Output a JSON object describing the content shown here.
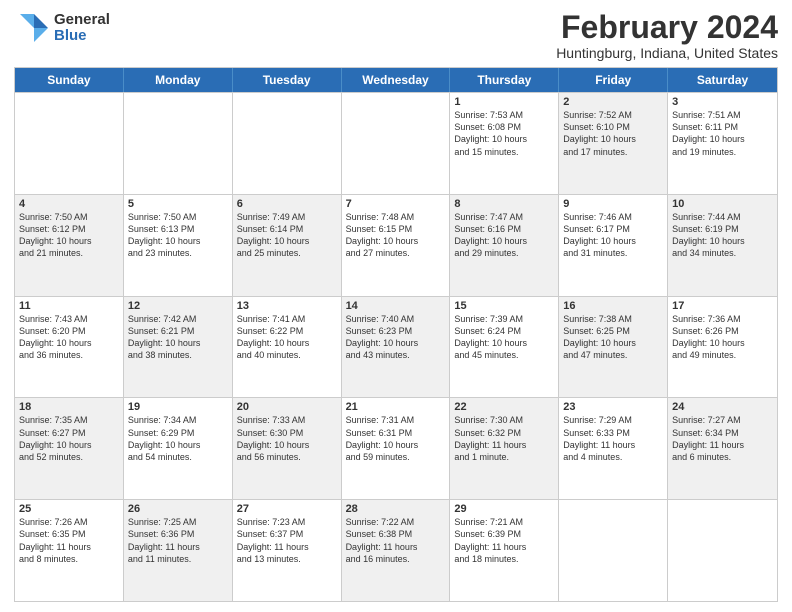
{
  "logo": {
    "general": "General",
    "blue": "Blue"
  },
  "title": "February 2024",
  "subtitle": "Huntingburg, Indiana, United States",
  "header_days": [
    "Sunday",
    "Monday",
    "Tuesday",
    "Wednesday",
    "Thursday",
    "Friday",
    "Saturday"
  ],
  "weeks": [
    [
      {
        "day": "",
        "text": "",
        "shaded": false
      },
      {
        "day": "",
        "text": "",
        "shaded": false
      },
      {
        "day": "",
        "text": "",
        "shaded": false
      },
      {
        "day": "",
        "text": "",
        "shaded": false
      },
      {
        "day": "1",
        "text": "Sunrise: 7:53 AM\nSunset: 6:08 PM\nDaylight: 10 hours\nand 15 minutes.",
        "shaded": false
      },
      {
        "day": "2",
        "text": "Sunrise: 7:52 AM\nSunset: 6:10 PM\nDaylight: 10 hours\nand 17 minutes.",
        "shaded": true
      },
      {
        "day": "3",
        "text": "Sunrise: 7:51 AM\nSunset: 6:11 PM\nDaylight: 10 hours\nand 19 minutes.",
        "shaded": false
      }
    ],
    [
      {
        "day": "4",
        "text": "Sunrise: 7:50 AM\nSunset: 6:12 PM\nDaylight: 10 hours\nand 21 minutes.",
        "shaded": true
      },
      {
        "day": "5",
        "text": "Sunrise: 7:50 AM\nSunset: 6:13 PM\nDaylight: 10 hours\nand 23 minutes.",
        "shaded": false
      },
      {
        "day": "6",
        "text": "Sunrise: 7:49 AM\nSunset: 6:14 PM\nDaylight: 10 hours\nand 25 minutes.",
        "shaded": true
      },
      {
        "day": "7",
        "text": "Sunrise: 7:48 AM\nSunset: 6:15 PM\nDaylight: 10 hours\nand 27 minutes.",
        "shaded": false
      },
      {
        "day": "8",
        "text": "Sunrise: 7:47 AM\nSunset: 6:16 PM\nDaylight: 10 hours\nand 29 minutes.",
        "shaded": true
      },
      {
        "day": "9",
        "text": "Sunrise: 7:46 AM\nSunset: 6:17 PM\nDaylight: 10 hours\nand 31 minutes.",
        "shaded": false
      },
      {
        "day": "10",
        "text": "Sunrise: 7:44 AM\nSunset: 6:19 PM\nDaylight: 10 hours\nand 34 minutes.",
        "shaded": true
      }
    ],
    [
      {
        "day": "11",
        "text": "Sunrise: 7:43 AM\nSunset: 6:20 PM\nDaylight: 10 hours\nand 36 minutes.",
        "shaded": false
      },
      {
        "day": "12",
        "text": "Sunrise: 7:42 AM\nSunset: 6:21 PM\nDaylight: 10 hours\nand 38 minutes.",
        "shaded": true
      },
      {
        "day": "13",
        "text": "Sunrise: 7:41 AM\nSunset: 6:22 PM\nDaylight: 10 hours\nand 40 minutes.",
        "shaded": false
      },
      {
        "day": "14",
        "text": "Sunrise: 7:40 AM\nSunset: 6:23 PM\nDaylight: 10 hours\nand 43 minutes.",
        "shaded": true
      },
      {
        "day": "15",
        "text": "Sunrise: 7:39 AM\nSunset: 6:24 PM\nDaylight: 10 hours\nand 45 minutes.",
        "shaded": false
      },
      {
        "day": "16",
        "text": "Sunrise: 7:38 AM\nSunset: 6:25 PM\nDaylight: 10 hours\nand 47 minutes.",
        "shaded": true
      },
      {
        "day": "17",
        "text": "Sunrise: 7:36 AM\nSunset: 6:26 PM\nDaylight: 10 hours\nand 49 minutes.",
        "shaded": false
      }
    ],
    [
      {
        "day": "18",
        "text": "Sunrise: 7:35 AM\nSunset: 6:27 PM\nDaylight: 10 hours\nand 52 minutes.",
        "shaded": true
      },
      {
        "day": "19",
        "text": "Sunrise: 7:34 AM\nSunset: 6:29 PM\nDaylight: 10 hours\nand 54 minutes.",
        "shaded": false
      },
      {
        "day": "20",
        "text": "Sunrise: 7:33 AM\nSunset: 6:30 PM\nDaylight: 10 hours\nand 56 minutes.",
        "shaded": true
      },
      {
        "day": "21",
        "text": "Sunrise: 7:31 AM\nSunset: 6:31 PM\nDaylight: 10 hours\nand 59 minutes.",
        "shaded": false
      },
      {
        "day": "22",
        "text": "Sunrise: 7:30 AM\nSunset: 6:32 PM\nDaylight: 11 hours\nand 1 minute.",
        "shaded": true
      },
      {
        "day": "23",
        "text": "Sunrise: 7:29 AM\nSunset: 6:33 PM\nDaylight: 11 hours\nand 4 minutes.",
        "shaded": false
      },
      {
        "day": "24",
        "text": "Sunrise: 7:27 AM\nSunset: 6:34 PM\nDaylight: 11 hours\nand 6 minutes.",
        "shaded": true
      }
    ],
    [
      {
        "day": "25",
        "text": "Sunrise: 7:26 AM\nSunset: 6:35 PM\nDaylight: 11 hours\nand 8 minutes.",
        "shaded": false
      },
      {
        "day": "26",
        "text": "Sunrise: 7:25 AM\nSunset: 6:36 PM\nDaylight: 11 hours\nand 11 minutes.",
        "shaded": true
      },
      {
        "day": "27",
        "text": "Sunrise: 7:23 AM\nSunset: 6:37 PM\nDaylight: 11 hours\nand 13 minutes.",
        "shaded": false
      },
      {
        "day": "28",
        "text": "Sunrise: 7:22 AM\nSunset: 6:38 PM\nDaylight: 11 hours\nand 16 minutes.",
        "shaded": true
      },
      {
        "day": "29",
        "text": "Sunrise: 7:21 AM\nSunset: 6:39 PM\nDaylight: 11 hours\nand 18 minutes.",
        "shaded": false
      },
      {
        "day": "",
        "text": "",
        "shaded": false
      },
      {
        "day": "",
        "text": "",
        "shaded": false
      }
    ]
  ]
}
